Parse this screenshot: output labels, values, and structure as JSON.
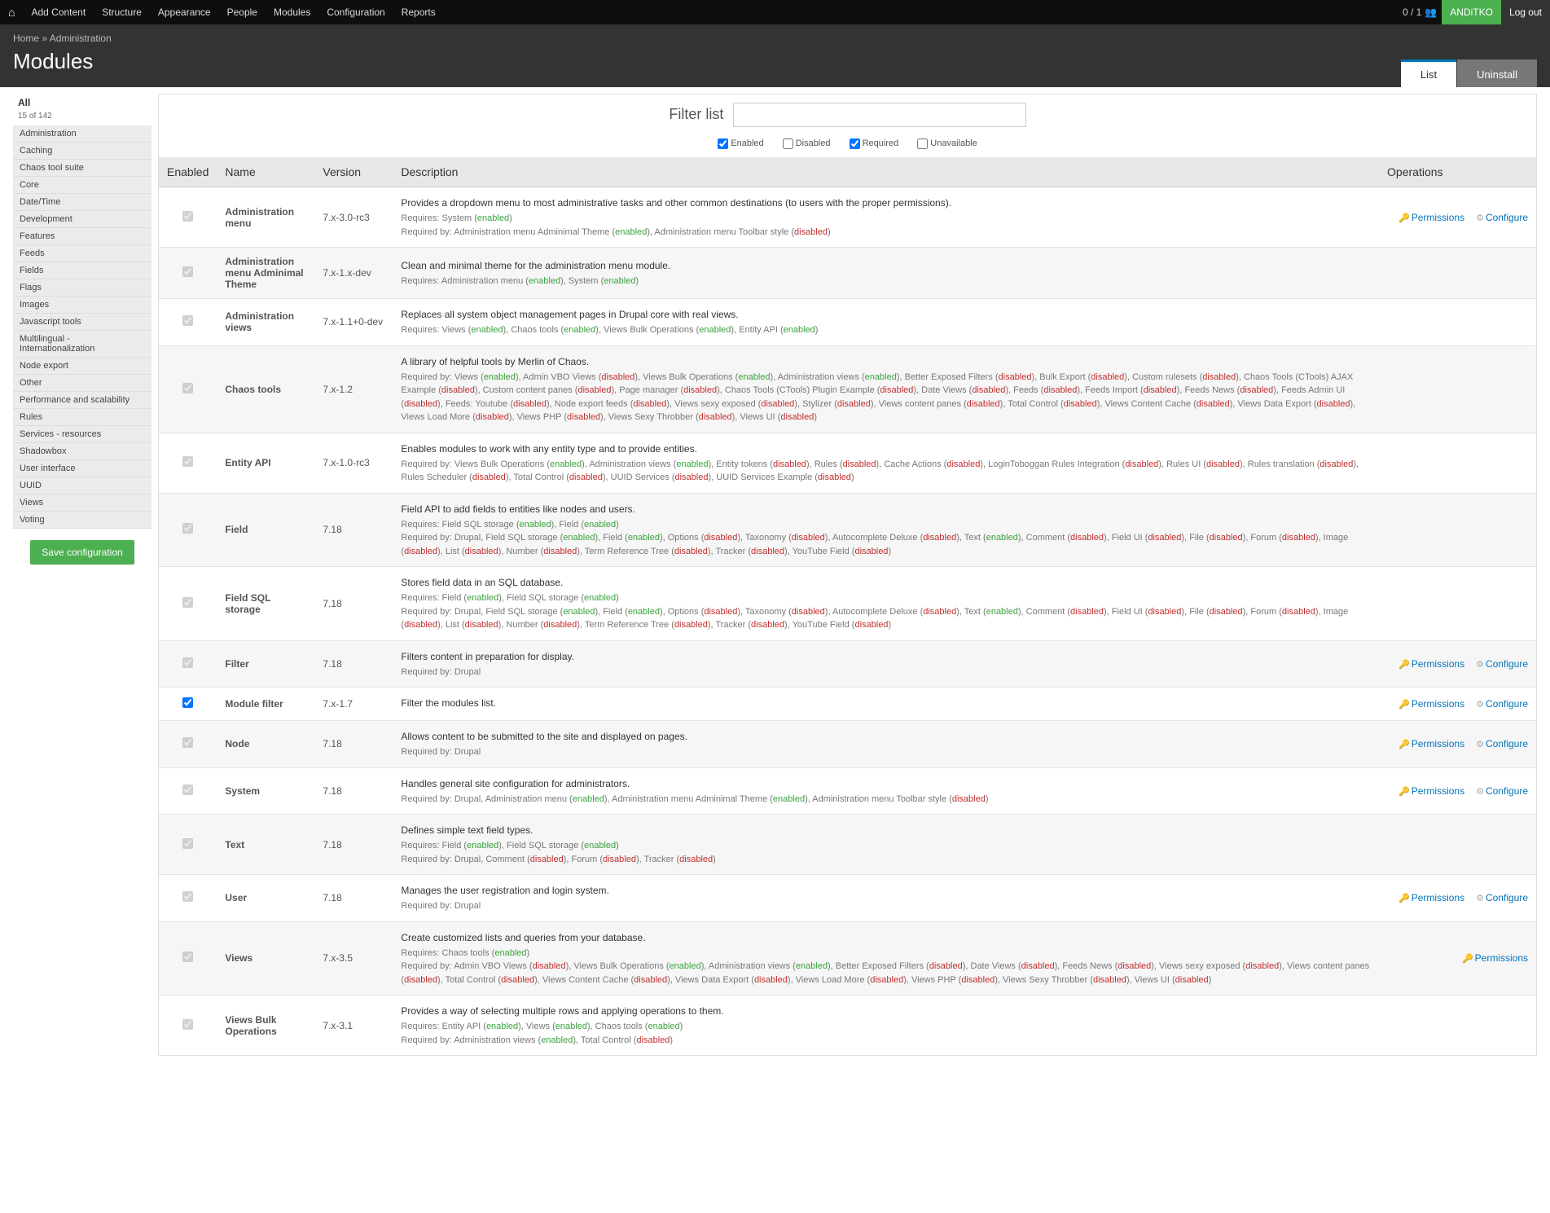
{
  "toolbar": {
    "items": [
      "Add Content",
      "Structure",
      "Appearance",
      "People",
      "Modules",
      "Configuration",
      "Reports"
    ],
    "count": "0 / 1",
    "user": "ANDiTKO",
    "logout": "Log out"
  },
  "breadcrumb": {
    "home": "Home",
    "sep": "»",
    "admin": "Administration"
  },
  "page_title": "Modules",
  "tabs": {
    "list": "List",
    "uninstall": "Uninstall"
  },
  "sidebar": {
    "all": "All",
    "count": "15 of 142",
    "items": [
      "Administration",
      "Caching",
      "Chaos tool suite",
      "Core",
      "Date/Time",
      "Development",
      "Features",
      "Feeds",
      "Fields",
      "Flags",
      "Images",
      "Javascript tools",
      "Multilingual - Internationalization",
      "Node export",
      "Other",
      "Performance and scalability",
      "Rules",
      "Services - resources",
      "Shadowbox",
      "User interface",
      "UUID",
      "Views",
      "Voting"
    ],
    "save": "Save configuration"
  },
  "filter": {
    "label": "Filter list",
    "placeholder": "",
    "enabled": "Enabled",
    "disabled": "Disabled",
    "required": "Required",
    "unavailable": "Unavailable"
  },
  "headers": {
    "enabled": "Enabled",
    "name": "Name",
    "version": "Version",
    "description": "Description",
    "operations": "Operations"
  },
  "ops": {
    "permissions": "Permissions",
    "configure": "Configure"
  },
  "rows": [
    {
      "checked": true,
      "disabledChk": true,
      "name": "Administration menu",
      "version": "7.x-3.0-rc3",
      "desc": "Provides a dropdown menu to most administrative tasks and other common destinations (to users with the proper permissions).",
      "sub": [
        [
          "Requires: System (",
          "enabled",
          ")"
        ],
        [
          "Required by: Administration menu Adminimal Theme (",
          "enabled",
          "), Administration menu Toolbar style (",
          "disabled",
          ")"
        ]
      ],
      "ops": [
        "permissions",
        "configure"
      ]
    },
    {
      "checked": true,
      "disabledChk": true,
      "name": "Administration menu Adminimal Theme",
      "version": "7.x-1.x-dev",
      "desc": "Clean and minimal theme for the administration menu module.",
      "sub": [
        [
          "Requires: Administration menu (",
          "enabled",
          "), System (",
          "enabled",
          ")"
        ]
      ],
      "ops": []
    },
    {
      "checked": true,
      "disabledChk": true,
      "name": "Administration views",
      "version": "7.x-1.1+0-dev",
      "desc": "Replaces all system object management pages in Drupal core with real views.",
      "sub": [
        [
          "Requires: Views (",
          "enabled",
          "), Chaos tools (",
          "enabled",
          "), Views Bulk Operations (",
          "enabled",
          "), Entity API (",
          "enabled",
          ")"
        ]
      ],
      "ops": []
    },
    {
      "checked": true,
      "disabledChk": true,
      "name": "Chaos tools",
      "version": "7.x-1.2",
      "desc": "A library of helpful tools by Merlin of Chaos.",
      "sub": [
        [
          "Required by: Views (",
          "enabled",
          "), Admin VBO Views (",
          "disabled",
          "), Views Bulk Operations (",
          "enabled",
          "), Administration views (",
          "enabled",
          "), Better Exposed Filters (",
          "disabled",
          "), Bulk Export (",
          "disabled",
          "), Custom rulesets (",
          "disabled",
          "), Chaos Tools (CTools) AJAX Example (",
          "disabled",
          "), Custom content panes (",
          "disabled",
          "), Page manager (",
          "disabled",
          "), Chaos Tools (CTools) Plugin Example (",
          "disabled",
          "), Date Views (",
          "disabled",
          "), Feeds (",
          "disabled",
          "), Feeds Import (",
          "disabled",
          "), Feeds News (",
          "disabled",
          "), Feeds Admin UI (",
          "disabled",
          "), Feeds: Youtube (",
          "disabled",
          "), Node export feeds (",
          "disabled",
          "), Views sexy exposed (",
          "disabled",
          "), Stylizer (",
          "disabled",
          "), Views content panes (",
          "disabled",
          "), Total Control (",
          "disabled",
          "), Views Content Cache (",
          "disabled",
          "), Views Data Export (",
          "disabled",
          "), Views Load More (",
          "disabled",
          "), Views PHP (",
          "disabled",
          "), Views Sexy Throbber (",
          "disabled",
          "), Views UI (",
          "disabled",
          ")"
        ]
      ],
      "ops": []
    },
    {
      "checked": true,
      "disabledChk": true,
      "name": "Entity API",
      "version": "7.x-1.0-rc3",
      "desc": "Enables modules to work with any entity type and to provide entities.",
      "sub": [
        [
          "Required by: Views Bulk Operations (",
          "enabled",
          "), Administration views (",
          "enabled",
          "), Entity tokens (",
          "disabled",
          "), Rules (",
          "disabled",
          "), Cache Actions (",
          "disabled",
          "), LoginToboggan Rules Integration (",
          "disabled",
          "), Rules UI (",
          "disabled",
          "), Rules translation (",
          "disabled",
          "), Rules Scheduler (",
          "disabled",
          "), Total Control (",
          "disabled",
          "), UUID Services (",
          "disabled",
          "), UUID Services Example (",
          "disabled",
          ")"
        ]
      ],
      "ops": []
    },
    {
      "checked": true,
      "disabledChk": true,
      "name": "Field",
      "version": "7.18",
      "desc": "Field API to add fields to entities like nodes and users.",
      "sub": [
        [
          "Requires: Field SQL storage (",
          "enabled",
          "), Field (",
          "enabled",
          ")"
        ],
        [
          "Required by: Drupal, Field SQL storage (",
          "enabled",
          "), Field (",
          "enabled",
          "), Options (",
          "disabled",
          "), Taxonomy (",
          "disabled",
          "), Autocomplete Deluxe (",
          "disabled",
          "), Text (",
          "enabled",
          "), Comment (",
          "disabled",
          "), Field UI (",
          "disabled",
          "), File (",
          "disabled",
          "), Forum (",
          "disabled",
          "), Image (",
          "disabled",
          "), List (",
          "disabled",
          "), Number (",
          "disabled",
          "), Term Reference Tree (",
          "disabled",
          "), Tracker (",
          "disabled",
          "), YouTube Field (",
          "disabled",
          ")"
        ]
      ],
      "ops": []
    },
    {
      "checked": true,
      "disabledChk": true,
      "name": "Field SQL storage",
      "version": "7.18",
      "desc": "Stores field data in an SQL database.",
      "sub": [
        [
          "Requires: Field (",
          "enabled",
          "), Field SQL storage (",
          "enabled",
          ")"
        ],
        [
          "Required by: Drupal, Field SQL storage (",
          "enabled",
          "), Field (",
          "enabled",
          "), Options (",
          "disabled",
          "), Taxonomy (",
          "disabled",
          "), Autocomplete Deluxe (",
          "disabled",
          "), Text (",
          "enabled",
          "), Comment (",
          "disabled",
          "), Field UI (",
          "disabled",
          "), File (",
          "disabled",
          "), Forum (",
          "disabled",
          "), Image (",
          "disabled",
          "), List (",
          "disabled",
          "), Number (",
          "disabled",
          "), Term Reference Tree (",
          "disabled",
          "), Tracker (",
          "disabled",
          "), YouTube Field (",
          "disabled",
          ")"
        ]
      ],
      "ops": []
    },
    {
      "checked": true,
      "disabledChk": true,
      "name": "Filter",
      "version": "7.18",
      "desc": "Filters content in preparation for display.",
      "sub": [
        [
          "Required by: Drupal"
        ]
      ],
      "ops": [
        "permissions",
        "configure"
      ]
    },
    {
      "checked": true,
      "disabledChk": false,
      "name": "Module filter",
      "version": "7.x-1.7",
      "desc": "Filter the modules list.",
      "sub": [],
      "ops": [
        "permissions",
        "configure"
      ]
    },
    {
      "checked": true,
      "disabledChk": true,
      "name": "Node",
      "version": "7.18",
      "desc": "Allows content to be submitted to the site and displayed on pages.",
      "sub": [
        [
          "Required by: Drupal"
        ]
      ],
      "ops": [
        "permissions",
        "configure"
      ]
    },
    {
      "checked": true,
      "disabledChk": true,
      "name": "System",
      "version": "7.18",
      "desc": "Handles general site configuration for administrators.",
      "sub": [
        [
          "Required by: Drupal, Administration menu (",
          "enabled",
          "), Administration menu Adminimal Theme (",
          "enabled",
          "), Administration menu Toolbar style (",
          "disabled",
          ")"
        ]
      ],
      "ops": [
        "permissions",
        "configure"
      ]
    },
    {
      "checked": true,
      "disabledChk": true,
      "name": "Text",
      "version": "7.18",
      "desc": "Defines simple text field types.",
      "sub": [
        [
          "Requires: Field (",
          "enabled",
          "), Field SQL storage (",
          "enabled",
          ")"
        ],
        [
          "Required by: Drupal, Comment (",
          "disabled",
          "), Forum (",
          "disabled",
          "), Tracker (",
          "disabled",
          ")"
        ]
      ],
      "ops": []
    },
    {
      "checked": true,
      "disabledChk": true,
      "name": "User",
      "version": "7.18",
      "desc": "Manages the user registration and login system.",
      "sub": [
        [
          "Required by: Drupal"
        ]
      ],
      "ops": [
        "permissions",
        "configure"
      ]
    },
    {
      "checked": true,
      "disabledChk": true,
      "name": "Views",
      "version": "7.x-3.5",
      "desc": "Create customized lists and queries from your database.",
      "sub": [
        [
          "Requires: Chaos tools (",
          "enabled",
          ")"
        ],
        [
          "Required by: Admin VBO Views (",
          "disabled",
          "), Views Bulk Operations (",
          "enabled",
          "), Administration views (",
          "enabled",
          "), Better Exposed Filters (",
          "disabled",
          "), Date Views (",
          "disabled",
          "), Feeds News (",
          "disabled",
          "), Views sexy exposed (",
          "disabled",
          "), Views content panes (",
          "disabled",
          "), Total Control (",
          "disabled",
          "), Views Content Cache (",
          "disabled",
          "), Views Data Export (",
          "disabled",
          "), Views Load More (",
          "disabled",
          "), Views PHP (",
          "disabled",
          "), Views Sexy Throbber (",
          "disabled",
          "), Views UI (",
          "disabled",
          ")"
        ]
      ],
      "ops": [
        "permissions"
      ]
    },
    {
      "checked": true,
      "disabledChk": true,
      "name": "Views Bulk Operations",
      "version": "7.x-3.1",
      "desc": "Provides a way of selecting multiple rows and applying operations to them.",
      "sub": [
        [
          "Requires: Entity API (",
          "enabled",
          "), Views (",
          "enabled",
          "), Chaos tools (",
          "enabled",
          ")"
        ],
        [
          "Required by: Administration views (",
          "enabled",
          "), Total Control (",
          "disabled",
          ")"
        ]
      ],
      "ops": []
    }
  ]
}
